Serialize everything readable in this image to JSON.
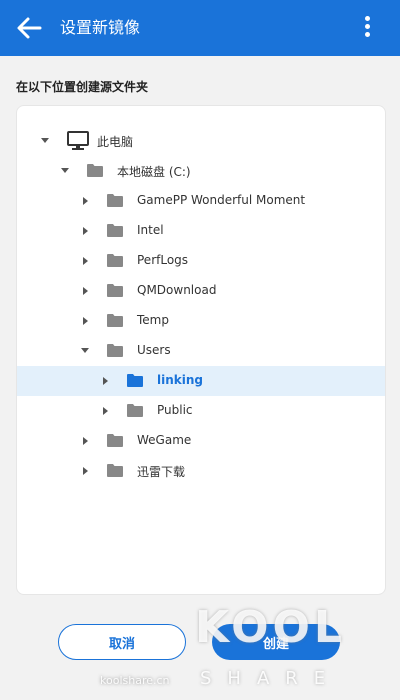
{
  "header": {
    "title": "设置新镜像",
    "back_icon": "arrow-left-icon",
    "menu_icon": "more-vertical-icon"
  },
  "section_label": "在以下位置创建源文件夹",
  "tree": [
    {
      "label": "此电脑",
      "depth": 0,
      "expanded": true,
      "icon": "monitor-icon",
      "selected": false
    },
    {
      "label": "本地磁盘 (C:)",
      "depth": 1,
      "expanded": true,
      "icon": "folder-icon",
      "selected": false
    },
    {
      "label": "GamePP Wonderful Moment",
      "depth": 2,
      "expanded": false,
      "icon": "folder-icon",
      "selected": false
    },
    {
      "label": "Intel",
      "depth": 2,
      "expanded": false,
      "icon": "folder-icon",
      "selected": false
    },
    {
      "label": "PerfLogs",
      "depth": 2,
      "expanded": false,
      "icon": "folder-icon",
      "selected": false
    },
    {
      "label": "QMDownload",
      "depth": 2,
      "expanded": false,
      "icon": "folder-icon",
      "selected": false
    },
    {
      "label": "Temp",
      "depth": 2,
      "expanded": false,
      "icon": "folder-icon",
      "selected": false
    },
    {
      "label": "Users",
      "depth": 2,
      "expanded": true,
      "icon": "folder-icon",
      "selected": false
    },
    {
      "label": "linking",
      "depth": 3,
      "expanded": false,
      "icon": "folder-icon",
      "selected": true
    },
    {
      "label": "Public",
      "depth": 3,
      "expanded": false,
      "icon": "folder-icon",
      "selected": false
    },
    {
      "label": "WeGame",
      "depth": 2,
      "expanded": false,
      "icon": "folder-icon",
      "selected": false
    },
    {
      "label": "迅雷下载",
      "depth": 2,
      "expanded": false,
      "icon": "folder-icon",
      "selected": false
    }
  ],
  "buttons": {
    "cancel": "取消",
    "create": "创建"
  },
  "watermark": {
    "logo": "KOOL",
    "sub": "SHARE",
    "site": "koolshare.cn"
  },
  "colors": {
    "accent": "#1a73d9",
    "selected_bg": "#e3f0fb",
    "folder": "#888888",
    "folder_selected": "#1a73d9"
  }
}
